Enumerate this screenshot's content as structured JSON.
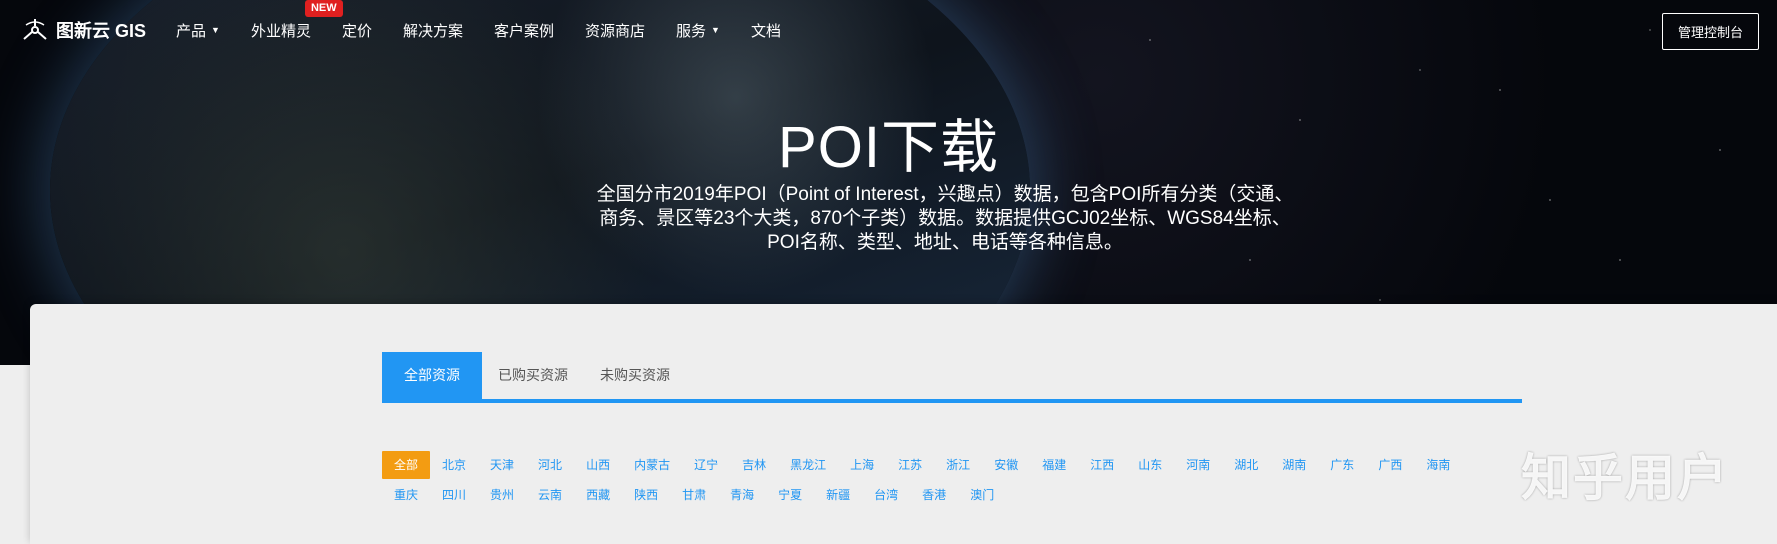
{
  "nav": {
    "logo_text": "图新云 GIS",
    "items": [
      {
        "label": "产品",
        "has_dropdown": true
      },
      {
        "label": "外业精灵",
        "badge": "NEW"
      },
      {
        "label": "定价"
      },
      {
        "label": "解决方案"
      },
      {
        "label": "客户案例"
      },
      {
        "label": "资源商店"
      },
      {
        "label": "服务",
        "has_dropdown": true
      },
      {
        "label": "文档"
      }
    ],
    "console_button": "管理控制台"
  },
  "hero": {
    "title": "POI下载",
    "description_lines": [
      "全国分市2019年POI（Point of Interest，兴趣点）数据，包含POI所有分类（交通、",
      "商务、景区等23个大类，870个子类）数据。数据提供GCJ02坐标、WGS84坐标、",
      "POI名称、类型、地址、电话等各种信息。"
    ]
  },
  "tabs": [
    "全部资源",
    "已购买资源",
    "未购买资源"
  ],
  "regions": {
    "row1": [
      "全部",
      "北京",
      "天津",
      "河北",
      "山西",
      "内蒙古",
      "辽宁",
      "吉林",
      "黑龙江",
      "上海",
      "江苏",
      "浙江",
      "安徽",
      "福建",
      "江西",
      "山东",
      "河南",
      "湖北",
      "湖南",
      "广东",
      "广西",
      "海南"
    ],
    "row2": [
      "重庆",
      "四川",
      "贵州",
      "云南",
      "西藏",
      "陕西",
      "甘肃",
      "青海",
      "宁夏",
      "新疆",
      "台湾",
      "香港",
      "澳门"
    ]
  },
  "watermark": "知乎用户",
  "colors": {
    "accent_blue": "#2196f3",
    "active_orange": "#f39c12",
    "badge_red": "#e02020"
  }
}
